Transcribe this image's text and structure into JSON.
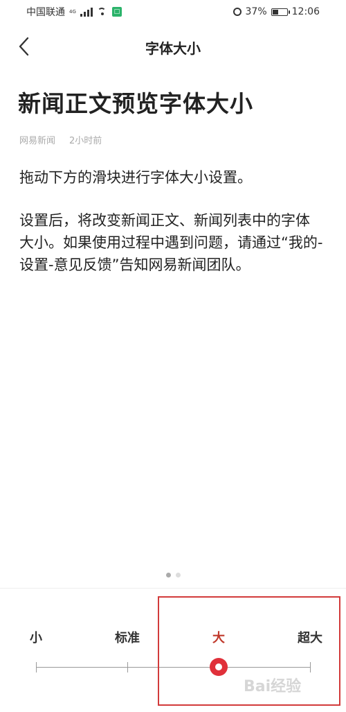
{
  "status_bar": {
    "carrier": "中国联通",
    "network": "4G",
    "battery": "37%",
    "time": "12:06"
  },
  "header": {
    "title": "字体大小"
  },
  "preview": {
    "headline": "新闻正文预览字体大小",
    "source": "网易新闻",
    "time_ago": "2小时前",
    "paragraphs": [
      "拖动下方的滑块进行字体大小设置。",
      "设置后，将改变新闻正文、新闻列表中的字体大小。如果使用过程中遇到问题，请通过“我的-设置-意见反馈”告知网易新闻团队。"
    ]
  },
  "pager": {
    "count": 2,
    "active_index": 0
  },
  "font_size_slider": {
    "labels": [
      "小",
      "标准",
      "大",
      "超大"
    ],
    "selected_index": 2,
    "accent_color": "#e0303a"
  },
  "watermark": "Bai经验"
}
